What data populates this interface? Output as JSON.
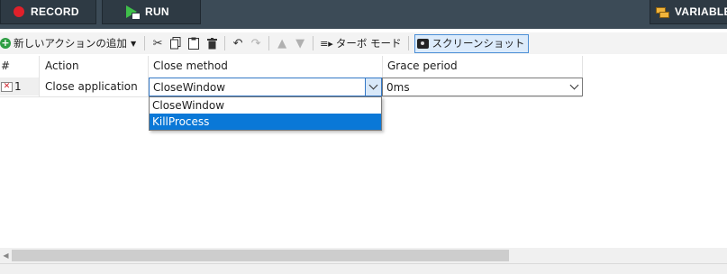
{
  "topbar": {
    "record_label": "RECORD",
    "run_label": "RUN",
    "variables_label": "VARIABLE"
  },
  "toolbar": {
    "add_action_label": "新しいアクションの追加",
    "turbo_mode_label": "ターボ モード",
    "screenshot_label": "スクリーンショット",
    "icons": [
      "cut-icon",
      "copy-icon",
      "paste-icon",
      "delete-icon",
      "undo-icon",
      "redo-icon",
      "move-up-icon",
      "move-down-icon"
    ]
  },
  "grid": {
    "headers": {
      "num": "#",
      "action": "Action",
      "close_method": "Close method",
      "grace_period": "Grace period"
    },
    "row": {
      "num": "1",
      "action": "Close application",
      "close_method_value": "CloseWindow",
      "grace_period_value": "0ms"
    },
    "dropdown_options": [
      {
        "label": "CloseWindow",
        "highlighted": false
      },
      {
        "label": "KillProcess",
        "highlighted": true
      }
    ]
  },
  "colors": {
    "topbar_bg": "#3c4b57",
    "record_red": "#e0202a",
    "run_green": "#3fbf4a",
    "highlight_blue": "#0a78d7"
  }
}
